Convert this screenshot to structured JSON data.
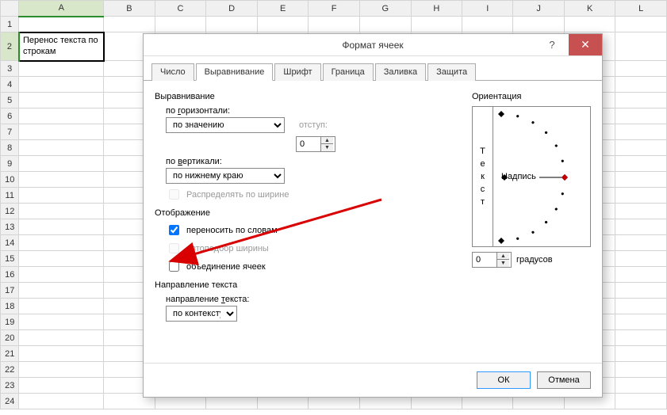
{
  "sheet": {
    "columns": [
      "",
      "A",
      "B",
      "C",
      "D",
      "E",
      "F",
      "G",
      "H",
      "I",
      "J",
      "K",
      "L"
    ],
    "rows": [
      "1",
      "2",
      "3",
      "4",
      "5",
      "6",
      "7",
      "8",
      "9",
      "10",
      "11",
      "12",
      "13",
      "14",
      "15",
      "16",
      "17",
      "18",
      "19",
      "20",
      "21",
      "22",
      "23",
      "24"
    ],
    "cell_A2": "Перенос текста по строкам"
  },
  "dialog": {
    "title": "Формат ячеек",
    "help": "?",
    "close": "✕",
    "tabs": [
      "Число",
      "Выравнивание",
      "Шрифт",
      "Граница",
      "Заливка",
      "Защита"
    ],
    "active_tab": 1,
    "alignment_group": "Выравнивание",
    "horiz_label": "по горизонтали:",
    "horiz_value": "по значению",
    "indent_label": "отступ:",
    "indent_value": "0",
    "vert_label": "по вертикали:",
    "vert_value": "по нижнему краю",
    "distribute_label": "Распределять по ширине",
    "display_group": "Отображение",
    "wrap_label": "переносить по словам",
    "autofit_label": "автоподбор ширины",
    "merge_label": "объединение ячеек",
    "direction_group": "Направление текста",
    "textdir_label": "направление текста:",
    "textdir_value": "по контексту",
    "orientation_group": "Ориентация",
    "vert_word": [
      "Т",
      "е",
      "к",
      "с",
      "т"
    ],
    "dial_label": "Надпись",
    "degrees_value": "0",
    "degrees_label": "градусов",
    "ok": "ОК",
    "cancel": "Отмена"
  }
}
